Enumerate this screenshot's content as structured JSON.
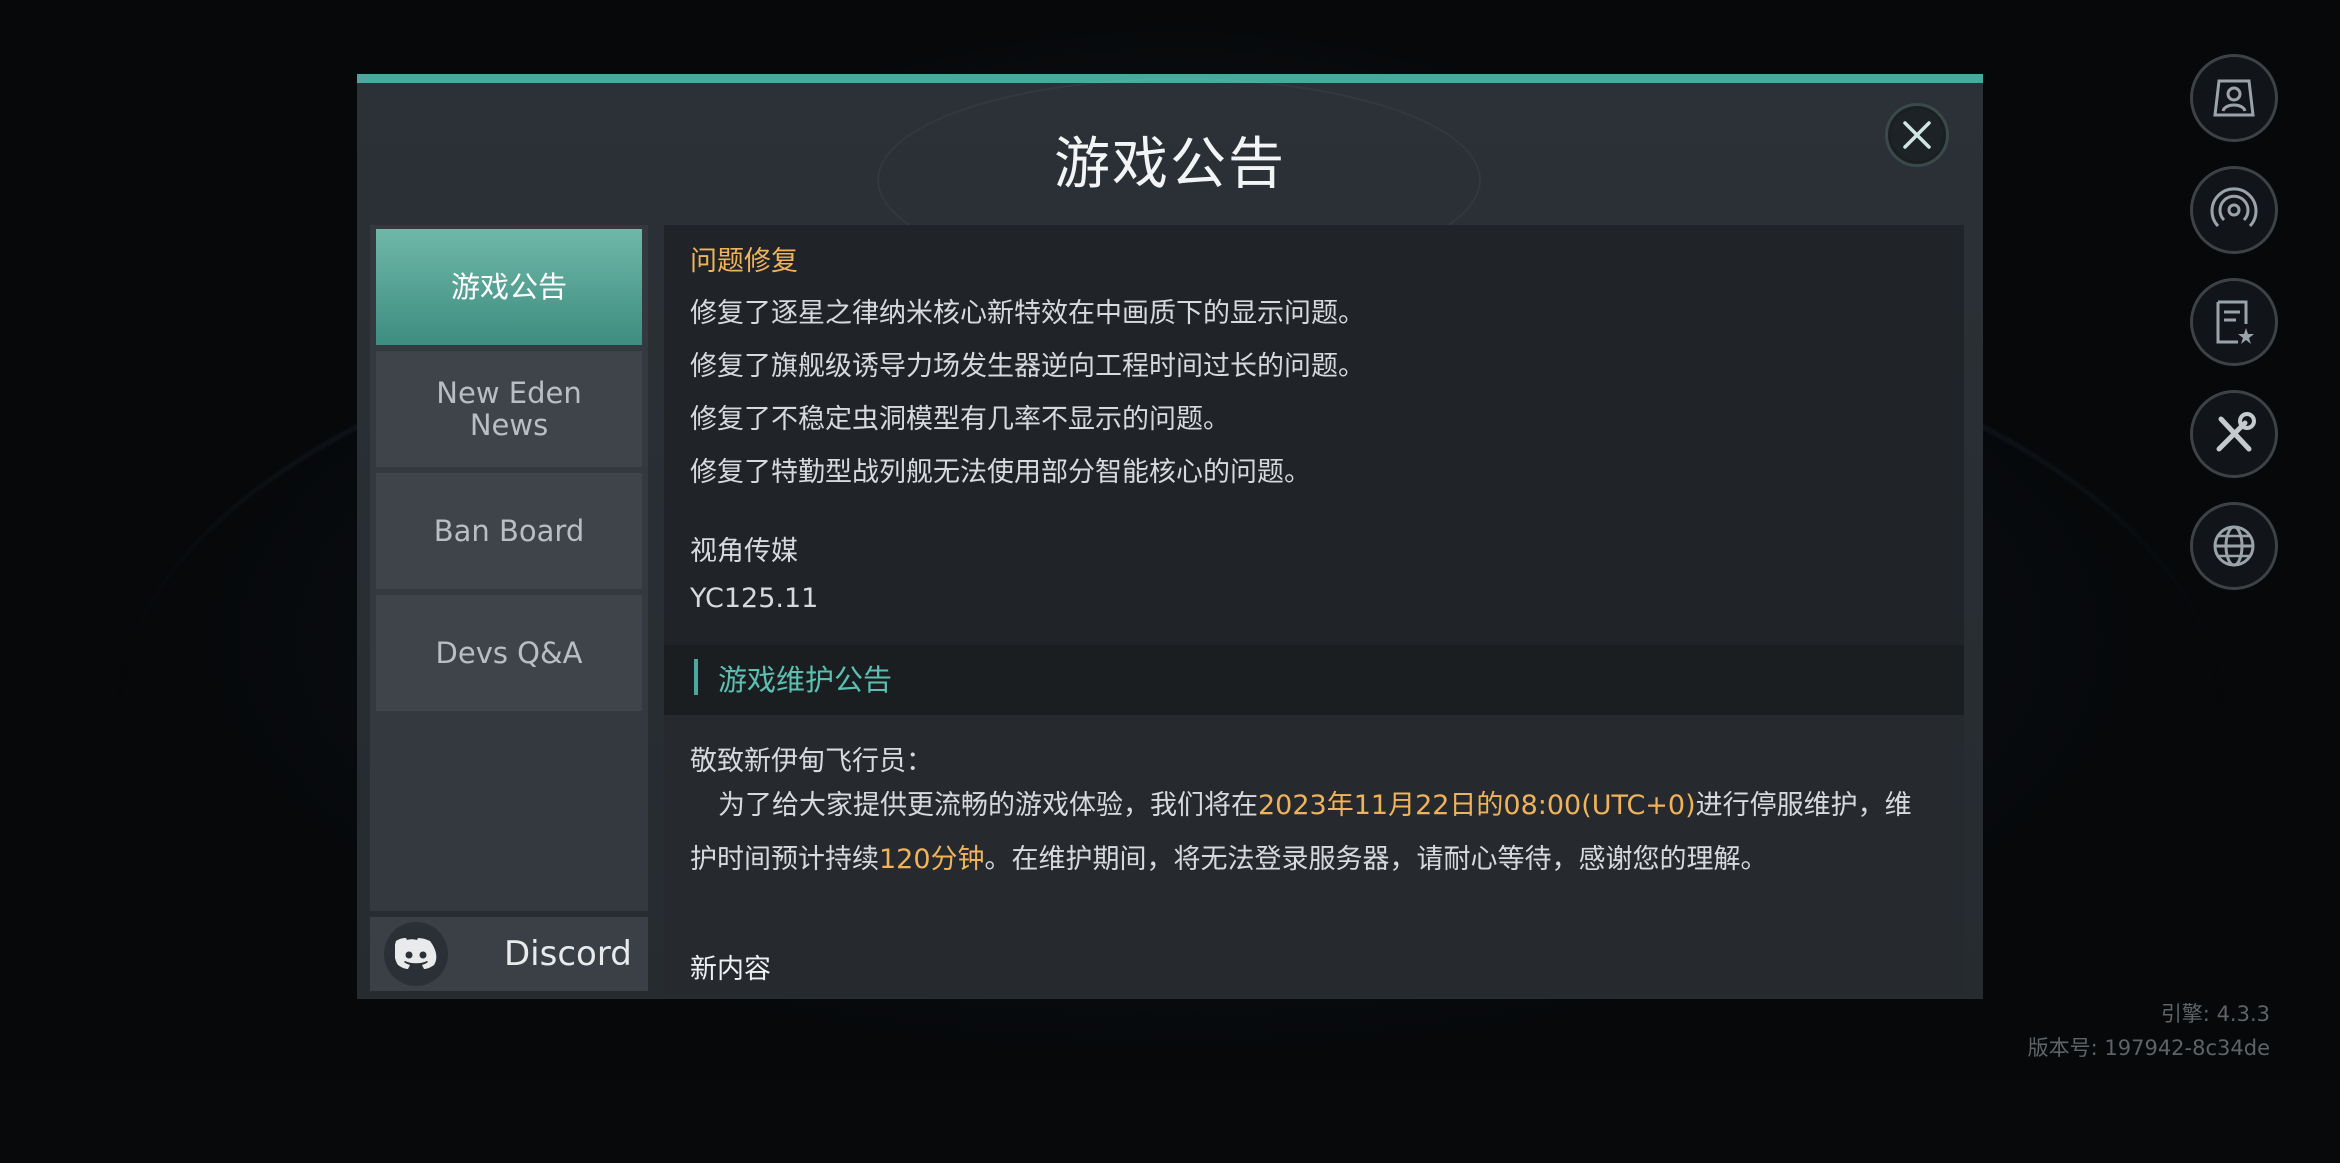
{
  "modal": {
    "title": "游戏公告"
  },
  "sidebar": {
    "tabs": [
      {
        "label": "游戏公告"
      },
      {
        "label": "New Eden\nNews"
      },
      {
        "label": "Ban Board"
      },
      {
        "label": "Devs Q&A"
      }
    ],
    "discord_label": "Discord"
  },
  "content": {
    "section1_title": "问题修复",
    "fixes": [
      "修复了逐星之律纳米核心新特效在中画质下的显示问题。",
      "修复了旗舰级诱导力场发生器逆向工程时间过长的问题。",
      "修复了不稳定虫洞模型有几率不显示的问题。",
      "修复了特勤型战列舰无法使用部分智能核心的问题。"
    ],
    "author": "视角传媒",
    "date": "YC125.11",
    "section2_title": "游戏维护公告",
    "greeting": "敬致新伊甸飞行员：",
    "para_a": "为了给大家提供更流畅的游戏体验，我们将在",
    "para_time": "2023年11月22日的08:00(UTC+0)",
    "para_b": "进行停服维护，维",
    "para_c": "护时间预计持续",
    "para_duration": "120分钟",
    "para_d": "。在维护期间，将无法登录服务器，请耐心等待，感谢您的理解。",
    "new_content": "新内容"
  },
  "footer": {
    "engine": "引擎: 4.3.3",
    "version": "版本号: 197942-8c34de"
  },
  "colors": {
    "accent": "#4aa89c",
    "highlight": "#f0b35a"
  },
  "icons": {
    "rail": [
      "profile-icon",
      "broadcast-icon",
      "notes-icon",
      "tools-icon",
      "globe-icon"
    ]
  }
}
